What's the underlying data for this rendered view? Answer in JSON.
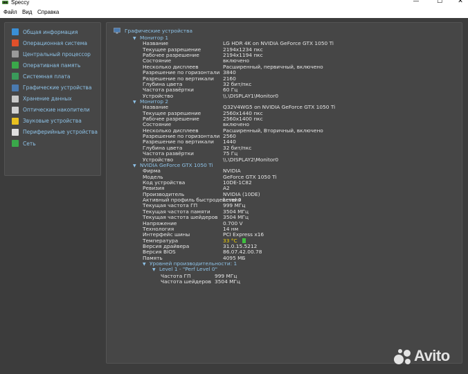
{
  "window": {
    "title": "Speccy",
    "minimize": "—",
    "maximize": "☐",
    "close": "✕"
  },
  "menu": {
    "file": "Файл",
    "view": "Вид",
    "help": "Справка"
  },
  "sidebar": {
    "items": [
      {
        "label": "Общая информация",
        "icon": "summary-icon",
        "color": "#3a8fd6"
      },
      {
        "label": "Операционная система",
        "icon": "windows-icon",
        "color": "#e0502a"
      },
      {
        "label": "Центральный процессор",
        "icon": "cpu-icon",
        "color": "#9a9a9a"
      },
      {
        "label": "Оперативная память",
        "icon": "ram-icon",
        "color": "#3aa84a"
      },
      {
        "label": "Системная плата",
        "icon": "motherboard-icon",
        "color": "#3a9a5a"
      },
      {
        "label": "Графические устройства",
        "icon": "monitor-icon",
        "color": "#4a7ab0"
      },
      {
        "label": "Хранение данных",
        "icon": "hdd-icon",
        "color": "#c8c8c8"
      },
      {
        "label": "Оптические накопители",
        "icon": "disc-icon",
        "color": "#d0d0d0"
      },
      {
        "label": "Звуковые устройства",
        "icon": "speaker-icon",
        "color": "#e8c020"
      },
      {
        "label": "Периферийные устройства",
        "icon": "mouse-icon",
        "color": "#e0e0e0"
      },
      {
        "label": "Сеть",
        "icon": "network-icon",
        "color": "#3aa84a"
      }
    ]
  },
  "content": {
    "section_title": "Графические устройства",
    "monitor1": {
      "title": "Монитор 1",
      "rows": [
        [
          "Название",
          "LG HDR 4K on NVIDIA GeForce GTX 1050 Ti"
        ],
        [
          "Текущее разрешение",
          "2194x1234 пкс"
        ],
        [
          "Рабочее разрешение",
          "2194x1194 пкс"
        ],
        [
          "Состояние",
          "включено"
        ],
        [
          "Несколько дисплеев",
          "Расширенный, первичный, включено"
        ],
        [
          "Разрешение по горизонтали",
          "3840"
        ],
        [
          "Разрешение по вертикали",
          "2160"
        ],
        [
          "Глубина цвета",
          "32 бит/пкс"
        ],
        [
          "Частота развёртки",
          "60 Гц"
        ],
        [
          "Устройство",
          "\\\\.\\DISPLAY1\\Monitor0"
        ]
      ]
    },
    "monitor2": {
      "title": "Монитор 2",
      "rows": [
        [
          "Название",
          "Q32V4WG5 on NVIDIA GeForce GTX 1050 Ti"
        ],
        [
          "Текущее разрешение",
          "2560x1440 пкс"
        ],
        [
          "Рабочее разрешение",
          "2560x1400 пкс"
        ],
        [
          "Состояние",
          "включено"
        ],
        [
          "Несколько дисплеев",
          "Расширенный, Вторичный, включено"
        ],
        [
          "Разрешение по горизонтали",
          "2560"
        ],
        [
          "Разрешение по вертикали",
          "1440"
        ],
        [
          "Глубина цвета",
          "32 бит/пкс"
        ],
        [
          "Частота развёртки",
          "75 Гц"
        ],
        [
          "Устройство",
          "\\\\.\\DISPLAY2\\Monitor0"
        ]
      ]
    },
    "gpu": {
      "title": "NVIDIA GeForce GTX 1050 Ti",
      "rows": [
        [
          "Фирма",
          "NVIDIA"
        ],
        [
          "Модель",
          "GeForce GTX 1050 Ti"
        ],
        [
          "Код устройства",
          "10DE-1C82"
        ],
        [
          "Ревизия",
          "A2"
        ],
        [
          "Производитель",
          "NVIDIA (10DE)"
        ],
        [
          "Активный профиль быстродействия",
          "Level 0"
        ],
        [
          "Текущая частота ГП",
          "999 МГц"
        ],
        [
          "Текущая частота памяти",
          "3504 МГц"
        ],
        [
          "Текущая частота шейдеров",
          "3504 МГц"
        ],
        [
          "Напряжение",
          "0.700 V"
        ],
        [
          "Технология",
          "14 нм"
        ],
        [
          "Интерфейс шины",
          "PCI Express x16"
        ],
        [
          "Температура",
          "33 °C"
        ],
        [
          "Версия драйвера",
          "31.0.15.5212"
        ],
        [
          "Версия BIOS",
          "86.07.42.00.78"
        ],
        [
          "Память",
          "4095 МБ"
        ]
      ],
      "perf": {
        "title": "Уровней производительности: 1",
        "level": {
          "title": "Level 1 - \"Perf Level 0\"",
          "rows": [
            [
              "Частота ГП",
              "999 МГц"
            ],
            [
              "Частота шейдеров",
              "3504 МГц"
            ]
          ]
        }
      }
    }
  },
  "watermark": {
    "text": "Avito"
  }
}
